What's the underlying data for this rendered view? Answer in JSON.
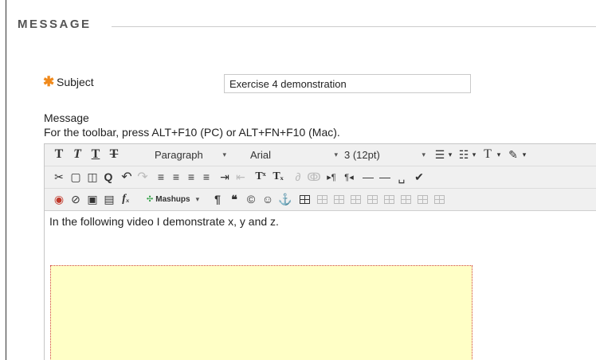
{
  "section": {
    "title": "MESSAGE"
  },
  "subject": {
    "required_mark": "✱",
    "label": "Subject",
    "value": "Exercise 4 demonstration"
  },
  "message": {
    "label": "Message",
    "hint": "For the toolbar, press ALT+F10 (PC) or ALT+FN+F10 (Mac)."
  },
  "toolbar": {
    "row1": {
      "bold": "T",
      "italic": "T",
      "underline": "T",
      "strike": "T",
      "format": "Paragraph",
      "font": "Arial",
      "size": "3 (12pt)"
    },
    "row3": {
      "mashups": "Mashups"
    }
  },
  "editor": {
    "content": "In the following video I demonstrate x, y and z."
  },
  "colors": {
    "required": "#f08a1c",
    "video_bg": "#ffffc6",
    "video_border": "#d04040",
    "toolbar_bg": "#f0f0f0"
  }
}
